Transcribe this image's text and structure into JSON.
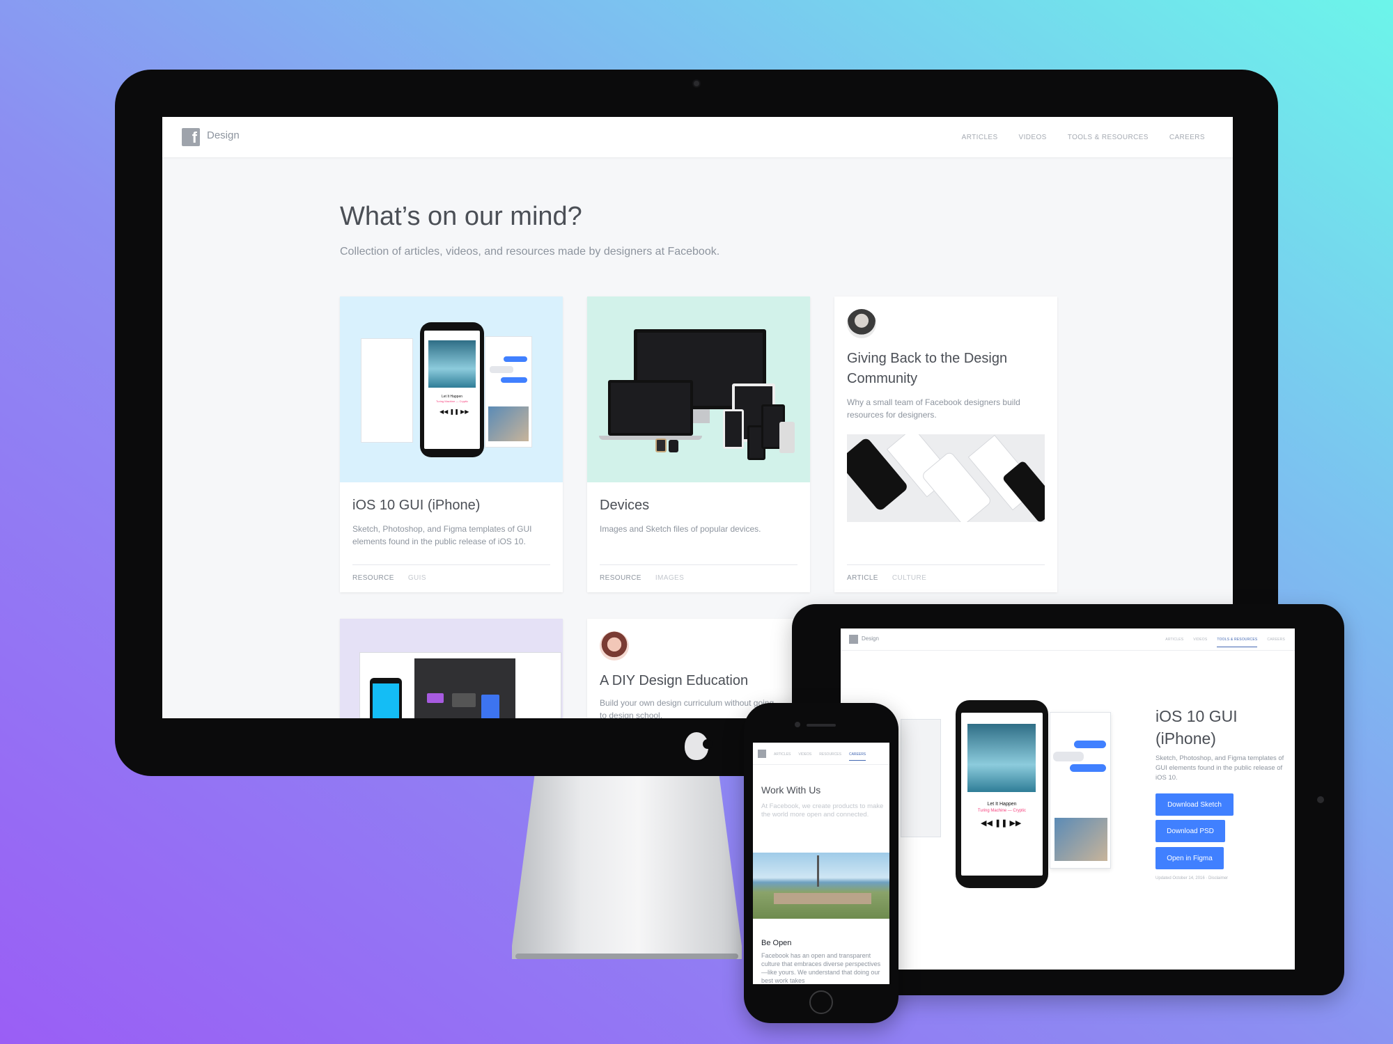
{
  "colors": {
    "bg_start": "#9a5ef5",
    "bg_end": "#6cf5ea",
    "accent": "#4080ff",
    "nav_active": "#4267b2"
  },
  "desktop": {
    "brand": "Design",
    "nav": [
      "ARTICLES",
      "VIDEOS",
      "TOOLS & RESOURCES",
      "CAREERS"
    ],
    "heading": "What’s on our mind?",
    "subheading": "Collection of articles, videos, and resources made by designers at Facebook.",
    "cards": [
      {
        "title": "iOS 10 GUI (iPhone)",
        "desc": "Sketch, Photoshop, and Figma templates of GUI elements found in the public release of iOS 10.",
        "tags": [
          "RESOURCE",
          "GUIS"
        ]
      },
      {
        "title": "Devices",
        "desc": "Images and Sketch files of popular devices.",
        "tags": [
          "RESOURCE",
          "IMAGES"
        ]
      },
      {
        "title": "Giving Back to the Design Community",
        "desc": "Why a small team of Facebook designers build resources for designers.",
        "tags": [
          "ARTICLE",
          "CULTURE"
        ]
      },
      {
        "title": "A DIY Design Education",
        "desc": "Build your own design curriculum without going to design school."
      }
    ],
    "phone_mock": {
      "song": "Let It Happen",
      "artist": "Turing Machine — Cryptic"
    }
  },
  "tablet": {
    "brand": "Design",
    "nav": [
      "ARTICLES",
      "VIDEOS",
      "TOOLS & RESOURCES",
      "CAREERS"
    ],
    "title": "iOS 10 GUI (iPhone)",
    "desc": "Sketch, Photoshop, and Figma templates of GUI elements found in the public release of iOS 10.",
    "buttons": [
      "Download Sketch",
      "Download PSD",
      "Open in Figma"
    ],
    "updated": "Updated October 14, 2016 · Disclaimer",
    "phone_mock": {
      "song": "Let It Happen",
      "artist": "Turing Machine — Cryptic"
    }
  },
  "mobile": {
    "nav": [
      "ARTICLES",
      "VIDEOS",
      "RESOURCES",
      "CAREERS"
    ],
    "title": "Work With Us",
    "desc": "At Facebook, we create products to make the world more open and connected.",
    "section_title": "Be Open",
    "section_text": "Facebook has an open and transparent culture that embraces diverse perspectives—like yours. We understand that doing our best work takes"
  }
}
